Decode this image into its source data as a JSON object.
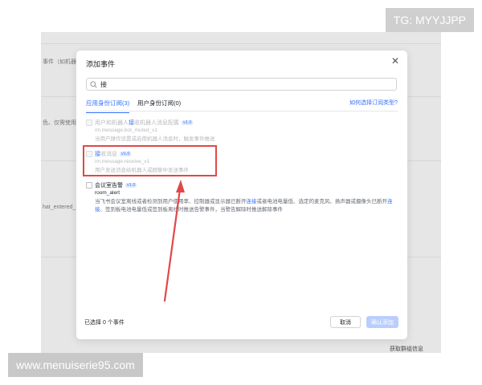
{
  "background": {
    "left_texts": [
      "事件（如机器",
      "色、仅需使用",
      "hat_entered_"
    ],
    "bottom_text": "获取群组信息"
  },
  "modal": {
    "title": "添加事件",
    "search": {
      "value": "接",
      "placeholder": ""
    },
    "tabs": [
      {
        "label": "应用身份订阅(3)",
        "active": true
      },
      {
        "label": "用户身份订阅(0)",
        "active": false
      }
    ],
    "help_link": "如何选择订阅类型?",
    "events": [
      {
        "name_pre": "用户和机器人",
        "name_hl": "接",
        "name_post": "收机器人消息配置",
        "version": "v1.0",
        "event_id": "im.message.bot_muted_v1",
        "description": "当用户操作设置或启用机器人消息时，触发事件推送",
        "disabled": true
      },
      {
        "name_pre": "",
        "name_hl": "接",
        "name_post": "收消息",
        "version": "v1.0",
        "event_id": "im.message.receive_v1",
        "description": "用户发送消息给机器人或群聊中发送事件",
        "disabled": true
      },
      {
        "name_pre": "会议室",
        "name_hl": "",
        "name_post": "告警",
        "version": "v1.0",
        "event_id": "room_alert",
        "description_1": "当飞书会议室离线或者检测到用户使用率、控制器或显示器已断开",
        "description_hl_1": "连接",
        "description_2": "或者电池电量低、选定的麦克风、扬声器或摄像头已断开",
        "description_hl_2": "连接",
        "description_3": "、签到板电池电量低或签到板离线时推送告警事件，当警告解除时推送解除事件",
        "disabled": false
      }
    ],
    "selected_count": "已选择 0 个事件",
    "cancel_label": "取消",
    "confirm_label": "确认添加"
  },
  "watermarks": {
    "top": "TG: MYYJJPP",
    "bottom": "www.menuiserie95.com"
  },
  "colors": {
    "accent": "#3370ff",
    "annotation": "#e04848"
  }
}
